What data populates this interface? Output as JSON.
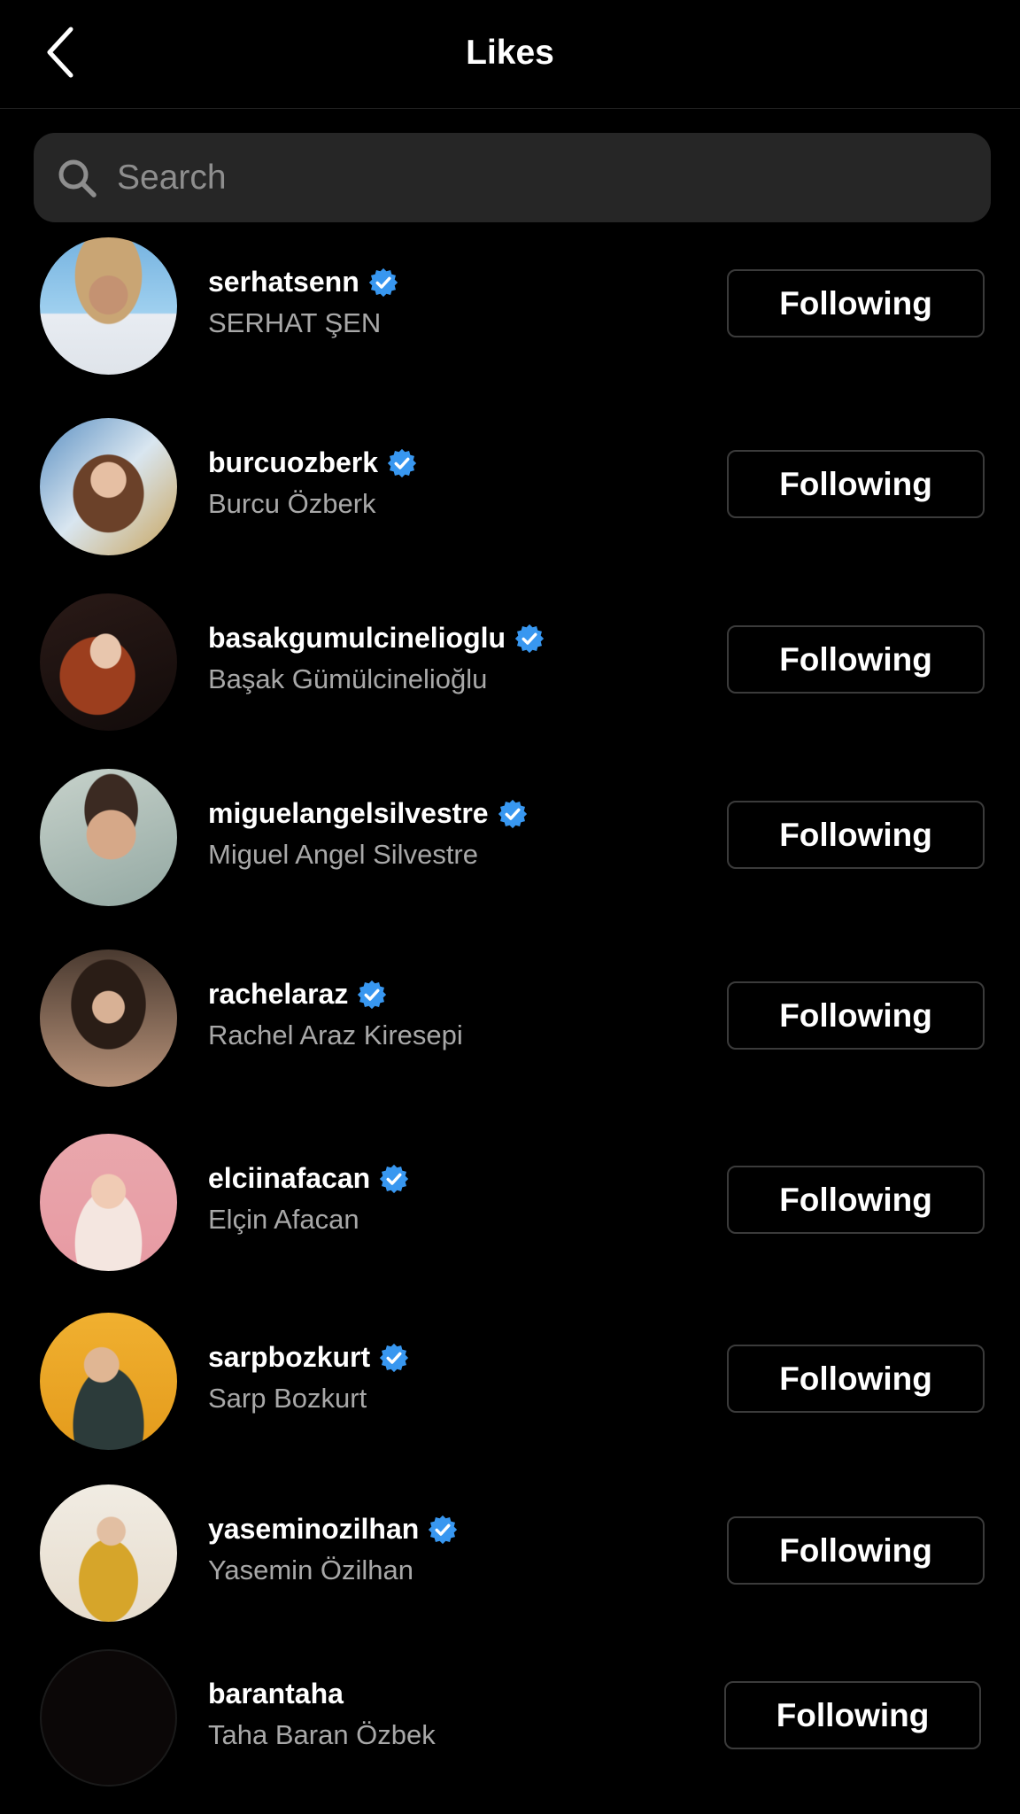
{
  "header": {
    "title": "Likes"
  },
  "search": {
    "placeholder": "Search"
  },
  "icons": {
    "back": "chevron-left-icon",
    "search": "search-icon",
    "verified": "verified-badge-icon"
  },
  "colors": {
    "background": "#000000",
    "verified": "#3897f0",
    "secondary_text": "#a8a8a8",
    "search_bg": "#262626",
    "button_border": "#3b3b3b"
  },
  "users": [
    {
      "username": "serhatsenn",
      "name": "SERHAT ŞEN",
      "verified": true,
      "button": "Following"
    },
    {
      "username": "burcuozberk",
      "name": "Burcu Özberk",
      "verified": true,
      "button": "Following"
    },
    {
      "username": "basakgumulcinelioglu",
      "name": "Başak Gümülcinelioğlu",
      "verified": true,
      "button": "Following"
    },
    {
      "username": "miguelangelsilvestre",
      "name": "Miguel Angel Silvestre",
      "verified": true,
      "button": "Following"
    },
    {
      "username": "rachelaraz",
      "name": "Rachel Araz Kiresepi",
      "verified": true,
      "button": "Following"
    },
    {
      "username": "elciinafacan",
      "name": "Elçin Afacan",
      "verified": true,
      "button": "Following"
    },
    {
      "username": "sarpbozkurt",
      "name": "Sarp Bozkurt",
      "verified": true,
      "button": "Following"
    },
    {
      "username": "yaseminozilhan",
      "name": "Yasemin Özilhan",
      "verified": true,
      "button": "Following"
    },
    {
      "username": "barantaha",
      "name": "Taha Baran Özbek",
      "verified": false,
      "button": "Following"
    }
  ]
}
